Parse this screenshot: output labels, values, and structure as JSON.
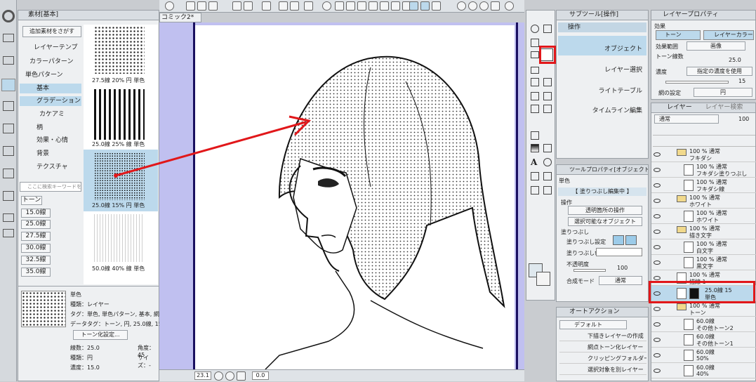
{
  "left_sidebar": {
    "search_icon_label": "Q"
  },
  "material_panel": {
    "tab_label": "素材[基本]",
    "search_button": "追加素材をさがす",
    "tree": [
      {
        "label": "レイヤーテンプ"
      },
      {
        "label": "カラーパターン"
      },
      {
        "label": "単色パターン"
      },
      {
        "label": "基本"
      },
      {
        "label": "グラデーション"
      },
      {
        "label": "カケアミ"
      },
      {
        "label": "柄"
      },
      {
        "label": "効果・心情"
      },
      {
        "label": "背景"
      },
      {
        "label": "テクスチャ"
      }
    ],
    "search_placeholder": "ここに検索キーワードを入",
    "tag_header": "トーン",
    "tags": [
      "15.0線",
      "25.0線",
      "27.5線",
      "30.0線",
      "32.5線",
      "35.0線"
    ],
    "thumbs": [
      {
        "caption": "27.5線 20% 円 単色"
      },
      {
        "caption": "25.0線 25% 線 単色"
      },
      {
        "caption": "25.0線 15% 円 単色"
      },
      {
        "caption": "50.0線 40% 線 単色"
      }
    ],
    "detail": {
      "name": "単色",
      "type": "種類：レイヤー",
      "tags": "タグ：単色, 単色パターン, 基本, 網",
      "datatags": "データタグ：トーン, 円, 25.0線, 15%",
      "tone_button": "トーン化設定...",
      "lines": "線数：25.0",
      "angle": "角度：45",
      "shape": "種類：円",
      "size": "サイズ：-",
      "density": "濃度：15.0"
    }
  },
  "toolbar": {
    "doc_tab": "コミック2*"
  },
  "canvas": {
    "zoom": "23.1",
    "angle": "0.0"
  },
  "subtool_panel": {
    "tab": "サブツール[操作]",
    "group": "操作",
    "items": [
      "オブジェクト",
      "レイヤー選択",
      "ライトテーブル",
      "タイムライン編集"
    ]
  },
  "tool_property": {
    "tab": "ツールプロパティ[オブジェクト]",
    "name": "単色",
    "status": "【 塗りつぶし編集中 】",
    "op_label": "操作",
    "op_value1": "透明箇所の操作",
    "op_value2": "選択可能なオブジェクト",
    "fill_label": "塗りつぶし",
    "fill_setting": "塗りつぶし設定",
    "fill_color": "塗りつぶし色",
    "opacity_label": "不透明度",
    "opacity_value": "100",
    "blend_label": "合成モード",
    "blend_value": "通常"
  },
  "auto_action": {
    "tab": "オートアクション",
    "set": "デフォルト",
    "items": [
      "下描きレイヤーの作成",
      "網点トーン化レイヤー",
      "クリッピングフォルダー作",
      "選択対象を別レイヤー"
    ]
  },
  "layer_property": {
    "tab": "レイヤープロパティ",
    "effect_label": "効果",
    "tone_btn": "トーン",
    "layercolor_btn": "レイヤーカラー",
    "range_label": "効果範囲",
    "range_value": "画像",
    "lines_label": "トーン線数",
    "lines_value": "25.0",
    "density_label": "濃度",
    "density_value": "指定の濃度を使用",
    "density_num": "15",
    "dot_label": "網の設定",
    "dot_value": "円"
  },
  "layer_panel": {
    "tab1": "レイヤー",
    "tab2": "レイヤー検索",
    "blend": "通常",
    "opacity": "100",
    "layers": [
      {
        "line1": "100 % 通常",
        "line2": "フキダシ",
        "kind": "folder",
        "indent": 0
      },
      {
        "line1": "100 % 通常",
        "line2": "フキダシ塗りつぶし",
        "kind": "layer",
        "indent": 1
      },
      {
        "line1": "100 % 通常",
        "line2": "フキダシ線",
        "kind": "layer",
        "indent": 1
      },
      {
        "line1": "100 % 通常",
        "line2": "ホワイト",
        "kind": "folder",
        "indent": 0
      },
      {
        "line1": "100 % 通常",
        "line2": "ホワイト",
        "kind": "layer",
        "indent": 1
      },
      {
        "line1": "100 % 通常",
        "line2": "描き文字",
        "kind": "folder",
        "indent": 0
      },
      {
        "line1": "100 % 通常",
        "line2": "白文字",
        "kind": "layer",
        "indent": 1
      },
      {
        "line1": "100 % 通常",
        "line2": "黒文字",
        "kind": "layer",
        "indent": 1
      },
      {
        "line1": "100 % 通常",
        "line2": "描線 1",
        "kind": "layer",
        "indent": 0
      },
      {
        "line1": "25.0線 15",
        "line2": "単色",
        "kind": "tone",
        "indent": 0
      },
      {
        "line1": "100 % 通常",
        "line2": "トーン",
        "kind": "folder",
        "indent": 0
      },
      {
        "line1": "60.0線",
        "line2": "その他トーン2",
        "kind": "layer",
        "indent": 1
      },
      {
        "line1": "60.0線",
        "line2": "その他トーン1",
        "kind": "layer",
        "indent": 1
      },
      {
        "line1": "60.0線",
        "line2": "50%",
        "kind": "layer",
        "indent": 1
      },
      {
        "line1": "60.0線",
        "line2": "40%",
        "kind": "layer",
        "indent": 1
      }
    ]
  }
}
